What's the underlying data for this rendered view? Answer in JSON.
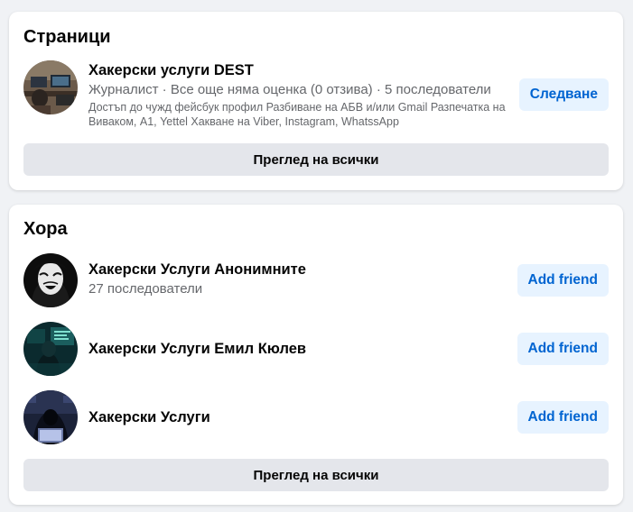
{
  "pages_section": {
    "title": "Страници",
    "items": [
      {
        "name": "Хакерски услуги DEST",
        "meta": "Журналист · Все още няма оценка (0 отзива) · 5 последователи",
        "description": "Достъп до чужд фейсбук профил Разбиване на АБВ и/или Gmail Разпечатка на Виваком, А1, Yettel Хакване на Viber, Instagram, WhatssApp",
        "action_label": "Следване"
      }
    ],
    "see_all_label": "Преглед на всички"
  },
  "people_section": {
    "title": "Хора",
    "items": [
      {
        "name": "Хакерски Услуги Анонимните",
        "meta": "27 последователи",
        "action_label": "Add friend"
      },
      {
        "name": "Хакерски Услуги Емил Кюлев",
        "meta": "",
        "action_label": "Add friend"
      },
      {
        "name": "Хакерски Услуги",
        "meta": "",
        "action_label": "Add friend"
      }
    ],
    "see_all_label": "Преглед на всички"
  },
  "colors": {
    "page_background": "#f0f2f5",
    "card_background": "#ffffff",
    "primary_button_bg": "#e7f3ff",
    "primary_button_text": "#0064d1",
    "secondary_button_bg": "#e4e6eb",
    "secondary_text": "#65676b"
  }
}
